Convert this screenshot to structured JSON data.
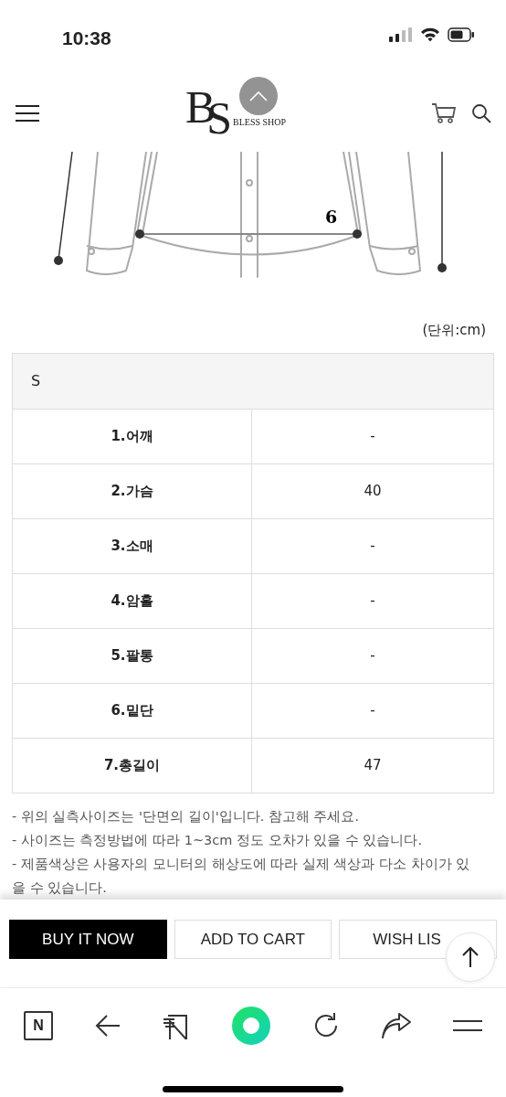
{
  "status_bar": {
    "time": "10:38"
  },
  "header": {
    "logo_letters": [
      "B",
      "S"
    ],
    "logo_text": "BLESS SHOP"
  },
  "diagram": {
    "measure_label": "6"
  },
  "unit_label": "(단위:cm)",
  "size_table": {
    "size": "S",
    "rows": [
      {
        "label": "1.어깨",
        "value": "-"
      },
      {
        "label": "2.가슴",
        "value": "40"
      },
      {
        "label": "3.소매",
        "value": "-"
      },
      {
        "label": "4.암홀",
        "value": "-"
      },
      {
        "label": "5.팔통",
        "value": "-"
      },
      {
        "label": "6.밑단",
        "value": "-"
      },
      {
        "label": "7.총길이",
        "value": "47"
      }
    ]
  },
  "notes": [
    "- 위의 실측사이즈는 '단면의 길이'입니다. 참고해 주세요.",
    "- 사이즈는 측정방법에 따라 1~3cm 정도 오차가 있을 수 있습니다.",
    "- 제품색상은 사용자의 모니터의 해상도에 따라 실제 색상과 다소 차이가 있을 수 있습니다."
  ],
  "actions": [
    {
      "label": "BUY IT NOW",
      "kind": "primary"
    },
    {
      "label": "ADD TO CART",
      "kind": "outline"
    },
    {
      "label": "WISH LIS",
      "kind": "outline"
    }
  ],
  "browser_toolbar": {
    "home_letter": "N"
  }
}
